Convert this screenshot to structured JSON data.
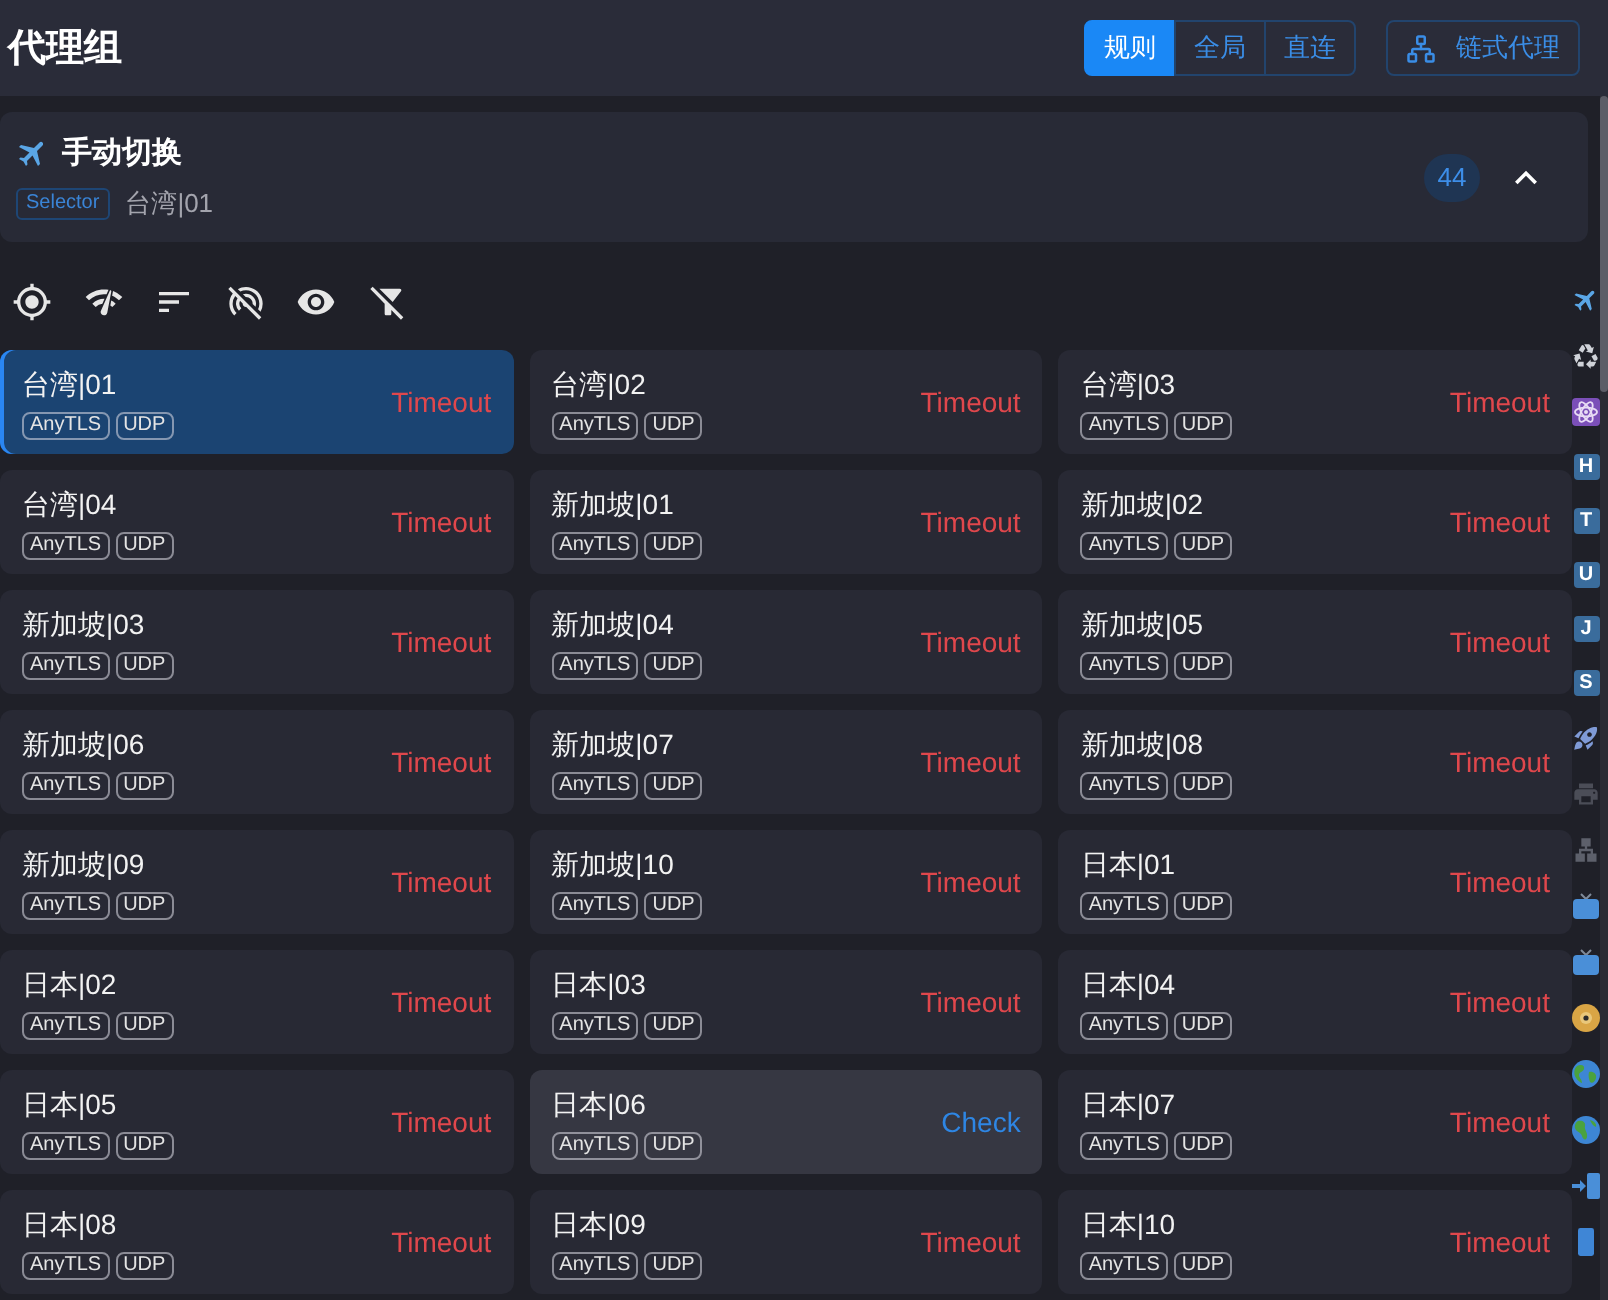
{
  "header": {
    "title": "代理组",
    "modes": [
      {
        "label": "规则",
        "selected": true
      },
      {
        "label": "全局",
        "selected": false
      },
      {
        "label": "直连",
        "selected": false
      }
    ],
    "chain_button": "链式代理"
  },
  "group": {
    "name": "手动切换",
    "type": "Selector",
    "current": "台湾|01",
    "count": "44",
    "expanded": true
  },
  "proxies": [
    {
      "name": "台湾|01",
      "tags": [
        "AnyTLS",
        "UDP"
      ],
      "status": "Timeout",
      "selected": true,
      "hovered": false
    },
    {
      "name": "台湾|02",
      "tags": [
        "AnyTLS",
        "UDP"
      ],
      "status": "Timeout",
      "selected": false,
      "hovered": false
    },
    {
      "name": "台湾|03",
      "tags": [
        "AnyTLS",
        "UDP"
      ],
      "status": "Timeout",
      "selected": false,
      "hovered": false
    },
    {
      "name": "台湾|04",
      "tags": [
        "AnyTLS",
        "UDP"
      ],
      "status": "Timeout",
      "selected": false,
      "hovered": false
    },
    {
      "name": "新加坡|01",
      "tags": [
        "AnyTLS",
        "UDP"
      ],
      "status": "Timeout",
      "selected": false,
      "hovered": false
    },
    {
      "name": "新加坡|02",
      "tags": [
        "AnyTLS",
        "UDP"
      ],
      "status": "Timeout",
      "selected": false,
      "hovered": false
    },
    {
      "name": "新加坡|03",
      "tags": [
        "AnyTLS",
        "UDP"
      ],
      "status": "Timeout",
      "selected": false,
      "hovered": false
    },
    {
      "name": "新加坡|04",
      "tags": [
        "AnyTLS",
        "UDP"
      ],
      "status": "Timeout",
      "selected": false,
      "hovered": false
    },
    {
      "name": "新加坡|05",
      "tags": [
        "AnyTLS",
        "UDP"
      ],
      "status": "Timeout",
      "selected": false,
      "hovered": false
    },
    {
      "name": "新加坡|06",
      "tags": [
        "AnyTLS",
        "UDP"
      ],
      "status": "Timeout",
      "selected": false,
      "hovered": false
    },
    {
      "name": "新加坡|07",
      "tags": [
        "AnyTLS",
        "UDP"
      ],
      "status": "Timeout",
      "selected": false,
      "hovered": false
    },
    {
      "name": "新加坡|08",
      "tags": [
        "AnyTLS",
        "UDP"
      ],
      "status": "Timeout",
      "selected": false,
      "hovered": false
    },
    {
      "name": "新加坡|09",
      "tags": [
        "AnyTLS",
        "UDP"
      ],
      "status": "Timeout",
      "selected": false,
      "hovered": false
    },
    {
      "name": "新加坡|10",
      "tags": [
        "AnyTLS",
        "UDP"
      ],
      "status": "Timeout",
      "selected": false,
      "hovered": false
    },
    {
      "name": "日本|01",
      "tags": [
        "AnyTLS",
        "UDP"
      ],
      "status": "Timeout",
      "selected": false,
      "hovered": false
    },
    {
      "name": "日本|02",
      "tags": [
        "AnyTLS",
        "UDP"
      ],
      "status": "Timeout",
      "selected": false,
      "hovered": false
    },
    {
      "name": "日本|03",
      "tags": [
        "AnyTLS",
        "UDP"
      ],
      "status": "Timeout",
      "selected": false,
      "hovered": false
    },
    {
      "name": "日本|04",
      "tags": [
        "AnyTLS",
        "UDP"
      ],
      "status": "Timeout",
      "selected": false,
      "hovered": false
    },
    {
      "name": "日本|05",
      "tags": [
        "AnyTLS",
        "UDP"
      ],
      "status": "Timeout",
      "selected": false,
      "hovered": false
    },
    {
      "name": "日本|06",
      "tags": [
        "AnyTLS",
        "UDP"
      ],
      "status": "Check",
      "selected": false,
      "hovered": true
    },
    {
      "name": "日本|07",
      "tags": [
        "AnyTLS",
        "UDP"
      ],
      "status": "Timeout",
      "selected": false,
      "hovered": false
    },
    {
      "name": "日本|08",
      "tags": [
        "AnyTLS",
        "UDP"
      ],
      "status": "Timeout",
      "selected": false,
      "hovered": false
    },
    {
      "name": "日本|09",
      "tags": [
        "AnyTLS",
        "UDP"
      ],
      "status": "Timeout",
      "selected": false,
      "hovered": false
    },
    {
      "name": "日本|10",
      "tags": [
        "AnyTLS",
        "UDP"
      ],
      "status": "Timeout",
      "selected": false,
      "hovered": false
    }
  ],
  "group_index": [
    {
      "kind": "plane"
    },
    {
      "kind": "recycle"
    },
    {
      "kind": "atom"
    },
    {
      "kind": "letter",
      "label": "H"
    },
    {
      "kind": "letter",
      "label": "T"
    },
    {
      "kind": "letter",
      "label": "U"
    },
    {
      "kind": "letter",
      "label": "J"
    },
    {
      "kind": "letter",
      "label": "S"
    },
    {
      "kind": "rocket"
    },
    {
      "kind": "printer"
    },
    {
      "kind": "network"
    },
    {
      "kind": "tv"
    },
    {
      "kind": "tv"
    },
    {
      "kind": "disc"
    },
    {
      "kind": "globe"
    },
    {
      "kind": "globe"
    },
    {
      "kind": "login"
    },
    {
      "kind": "panel"
    }
  ]
}
